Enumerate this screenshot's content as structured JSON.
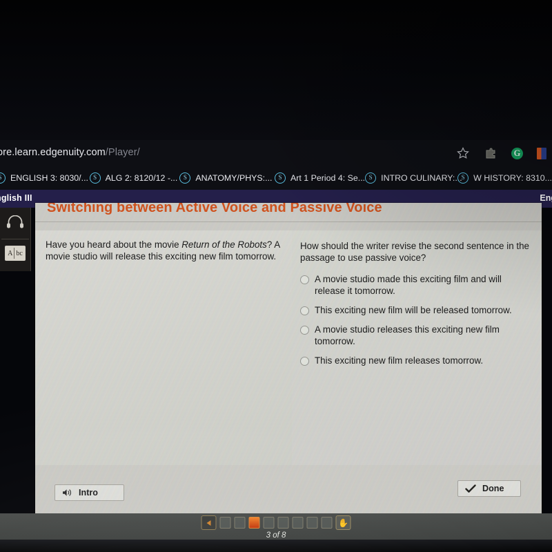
{
  "browser": {
    "url_host": "ore.learn.edgenuity.com",
    "url_path": "/Player/",
    "icons": {
      "bookmark_star": "star-icon",
      "extensions": "extensions-puzzle-icon",
      "grammarly": "G",
      "profile": "E"
    },
    "bookmarks": [
      {
        "label": "ENGLISH 3: 8030/...",
        "favicon": "S"
      },
      {
        "label": "ALG 2: 8120/12 -...",
        "favicon": "S"
      },
      {
        "label": "ANATOMY/PHYS:...",
        "favicon": "S"
      },
      {
        "label": "Art 1 Period 4: Se...",
        "favicon": "S"
      },
      {
        "label": "INTRO CULINARY:...",
        "favicon": "S"
      },
      {
        "label": "W HISTORY: 8310...",
        "favicon": "S"
      }
    ]
  },
  "appbar": {
    "course_left": "nglish III",
    "course_right": "Eng",
    "background": "#241f4a"
  },
  "rail": {
    "items": [
      {
        "name": "audio-headphones",
        "icon": "headphones-icon"
      },
      {
        "name": "glossary-dictionary",
        "icon": "dictionary-icon",
        "letters_left": "A",
        "letters_right": "bc"
      }
    ]
  },
  "lesson": {
    "title": "Switching between Active Voice and Passive Voice",
    "title_color": "#d4541f",
    "passage_part1": "Have you heard about the movie ",
    "passage_italic": "Return of the Robots",
    "passage_part2": "? A movie studio will release this exciting new film tomorrow.",
    "prompt": "How should the writer revise the second sentence in the passage to use passive voice?",
    "choices": [
      {
        "id": "a",
        "text": "A movie studio made this exciting film and will release it tomorrow.",
        "selected": false
      },
      {
        "id": "b",
        "text": "This exciting new film will be released tomorrow.",
        "selected": false
      },
      {
        "id": "c",
        "text": "A movie studio releases this exciting new film tomorrow.",
        "selected": false
      },
      {
        "id": "d",
        "text": "This exciting new film releases tomorrow.",
        "selected": false
      }
    ],
    "intro_button": "Intro",
    "done_button": "Done"
  },
  "player": {
    "prev_label": "Previous",
    "hand_label": "Pointer tool",
    "slides": [
      {
        "index": 1,
        "active": false
      },
      {
        "index": 2,
        "active": false
      },
      {
        "index": 3,
        "active": true
      },
      {
        "index": 4,
        "active": false
      },
      {
        "index": 5,
        "active": false
      },
      {
        "index": 6,
        "active": false
      },
      {
        "index": 7,
        "active": false
      },
      {
        "index": 8,
        "active": false
      }
    ],
    "counter": "3 of 8",
    "active_color": "#e0761f"
  }
}
